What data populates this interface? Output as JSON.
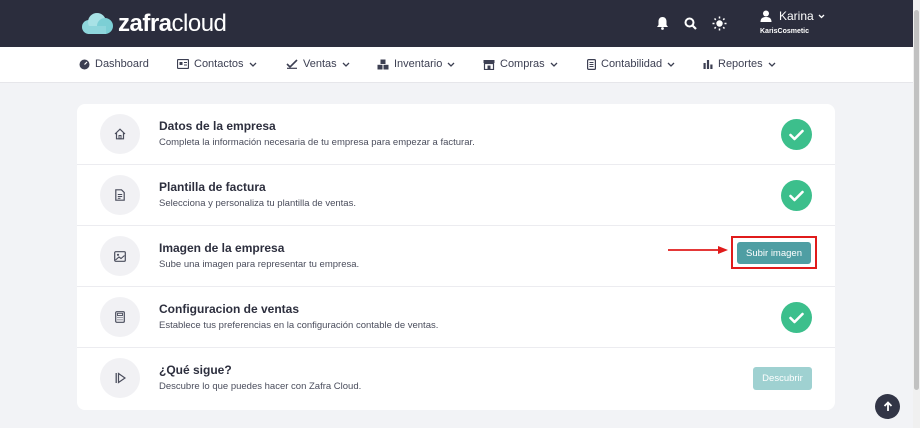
{
  "brand": {
    "logo_bold": "zafra",
    "logo_light": "cloud"
  },
  "user": {
    "name": "Karina",
    "company": "KarisCosmetic"
  },
  "icons": {
    "bell": "bell-icon",
    "search": "search-icon",
    "theme": "sun-icon",
    "user": "user-icon",
    "scroll_top": "arrow-up-icon"
  },
  "nav": {
    "items": [
      {
        "label": "Dashboard",
        "icon": "dashboard-icon",
        "dropdown": false
      },
      {
        "label": "Contactos",
        "icon": "contacts-card-icon",
        "dropdown": true
      },
      {
        "label": "Ventas",
        "icon": "sales-icon",
        "dropdown": true
      },
      {
        "label": "Inventario",
        "icon": "inventory-boxes-icon",
        "dropdown": true
      },
      {
        "label": "Compras",
        "icon": "store-icon",
        "dropdown": true
      },
      {
        "label": "Contabilidad",
        "icon": "ledger-icon",
        "dropdown": true
      },
      {
        "label": "Reportes",
        "icon": "bar-chart-icon",
        "dropdown": true
      }
    ]
  },
  "setup": {
    "steps": [
      {
        "title": "Datos de la empresa",
        "description": "Completa la información necesaria de tu empresa para empezar a facturar.",
        "icon": "home-icon",
        "status": "complete"
      },
      {
        "title": "Plantilla de factura",
        "description": "Selecciona y personaliza tu plantilla de ventas.",
        "icon": "document-icon",
        "status": "complete"
      },
      {
        "title": "Imagen de la empresa",
        "description": "Sube una imagen para representar tu empresa.",
        "icon": "image-icon",
        "status": "pending",
        "action": "Subir imagen"
      },
      {
        "title": "Configuracion de ventas",
        "description": "Establece tus preferencias en la configuración contable de ventas.",
        "icon": "calculator-icon",
        "status": "complete"
      },
      {
        "title": "¿Qué sigue?",
        "description": "Descubre lo que puedes hacer con Zafra Cloud.",
        "icon": "play-icon",
        "status": "next",
        "action": "Descubrir"
      }
    ]
  },
  "colors": {
    "topbar": "#2b2d3d",
    "success": "#3cbf8c",
    "action": "#4f9ea3",
    "action_disabled": "#9fd1d1",
    "highlight": "#e01b1b"
  }
}
